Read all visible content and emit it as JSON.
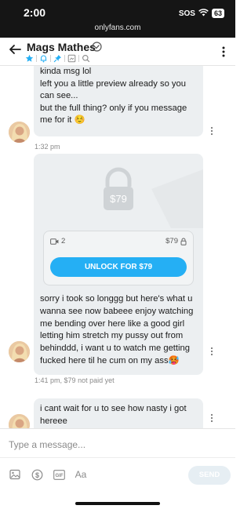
{
  "status_bar": {
    "time": "2:00",
    "sos": "SOS",
    "battery": "63"
  },
  "browser": {
    "url": "onlyfans.com"
  },
  "header": {
    "name": "Mags Mathes"
  },
  "messages": [
    {
      "text": "kinda msg lol\nleft you a little preview already so you can see...\nbut the full thing? only if you message me for it ☺️",
      "time": "1:32 pm"
    },
    {
      "media": {
        "preview_price": "$79",
        "video_count": "2",
        "price": "$79",
        "unlock_label": "UNLOCK FOR $79"
      },
      "text": "sorry i took so longgg but here's what u wanna see now babeee enjoy watching me bending over here like a good girl letting him stretch my pussy out from behinddd, i want u to watch me getting fucked here til he cum on my ass🥵",
      "time": "1:41 pm,",
      "status": "$79 not paid yet"
    },
    {
      "text": "i cant wait for u to see how nasty i got hereee"
    }
  ],
  "composer": {
    "placeholder": "Type a message...",
    "text_tool_label": "Aa",
    "gif_label": "GIF",
    "send_label": "SEND"
  },
  "colors": {
    "accent": "#25aff4",
    "bubble": "#eceff1",
    "status_bar": "#151515"
  }
}
